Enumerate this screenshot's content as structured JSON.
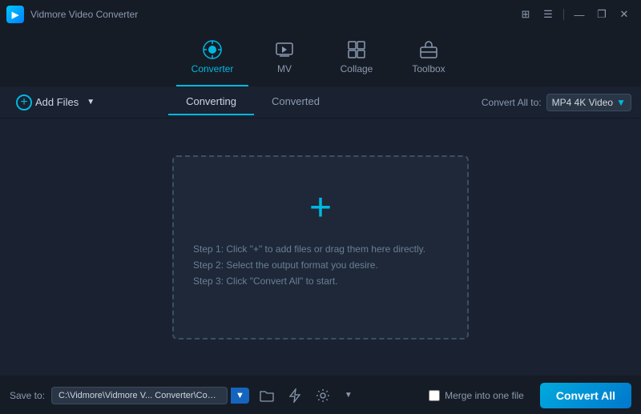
{
  "titleBar": {
    "appName": "Vidmore Video Converter",
    "controls": {
      "minimize": "—",
      "restore": "❐",
      "close": "✕",
      "menu": "☰",
      "grid": "⊞"
    }
  },
  "navTabs": [
    {
      "id": "converter",
      "label": "Converter",
      "active": true
    },
    {
      "id": "mv",
      "label": "MV",
      "active": false
    },
    {
      "id": "collage",
      "label": "Collage",
      "active": false
    },
    {
      "id": "toolbox",
      "label": "Toolbox",
      "active": false
    }
  ],
  "toolbar": {
    "addFiles": "Add Files",
    "converting": "Converting",
    "converted": "Converted",
    "convertAllTo": "Convert All to:",
    "format": "MP4 4K Video"
  },
  "dropZone": {
    "plusSymbol": "+",
    "step1": "Step 1: Click \"+\" to add files or drag them here directly.",
    "step2": "Step 2: Select the output format you desire.",
    "step3": "Step 3: Click \"Convert All\" to start."
  },
  "bottomBar": {
    "saveToLabel": "Save to:",
    "path": "C:\\Vidmore\\Vidmore V... Converter\\Converted",
    "mergeLabel": "Merge into one file",
    "convertAll": "Convert All"
  },
  "colors": {
    "accent": "#00b8e0",
    "bg": "#1a2130",
    "darkBg": "#161c26",
    "convertBtn": "#0099dd"
  }
}
